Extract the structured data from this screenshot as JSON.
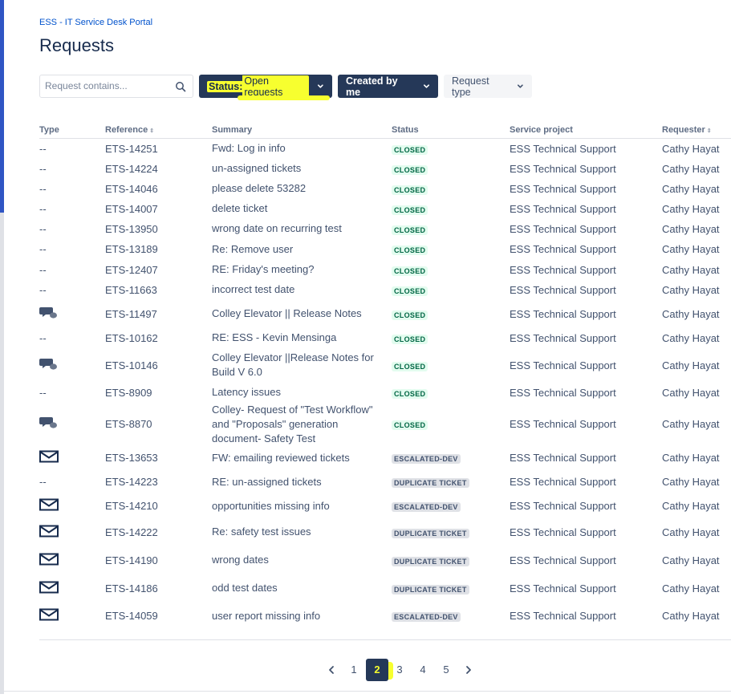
{
  "breadcrumb": "ESS - IT Service Desk Portal",
  "page_title": "Requests",
  "search": {
    "placeholder": "Request contains..."
  },
  "filters": {
    "status_label": "Status:",
    "status_value": "Open requests",
    "created_by": "Created by me",
    "request_type": "Request type"
  },
  "table": {
    "headers": [
      "Type",
      "Reference",
      "Summary",
      "Status",
      "Service project",
      "Requester"
    ],
    "rows": [
      {
        "type": "--",
        "ref": "ETS-14251",
        "summary": "Fwd: Log in info",
        "status": "CLOSED",
        "project": "ESS Technical Support",
        "requester": "Cathy Hayat"
      },
      {
        "type": "--",
        "ref": "ETS-14224",
        "summary": "un-assigned tickets",
        "status": "CLOSED",
        "project": "ESS Technical Support",
        "requester": "Cathy Hayat"
      },
      {
        "type": "--",
        "ref": "ETS-14046",
        "summary": "please delete 53282",
        "status": "CLOSED",
        "project": "ESS Technical Support",
        "requester": "Cathy Hayat"
      },
      {
        "type": "--",
        "ref": "ETS-14007",
        "summary": "delete ticket",
        "status": "CLOSED",
        "project": "ESS Technical Support",
        "requester": "Cathy Hayat"
      },
      {
        "type": "--",
        "ref": "ETS-13950",
        "summary": "wrong date on recurring test",
        "status": "CLOSED",
        "project": "ESS Technical Support",
        "requester": "Cathy Hayat"
      },
      {
        "type": "--",
        "ref": "ETS-13189",
        "summary": "Re: Remove user",
        "status": "CLOSED",
        "project": "ESS Technical Support",
        "requester": "Cathy Hayat"
      },
      {
        "type": "--",
        "ref": "ETS-12407",
        "summary": "RE: Friday's meeting?",
        "status": "CLOSED",
        "project": "ESS Technical Support",
        "requester": "Cathy Hayat"
      },
      {
        "type": "--",
        "ref": "ETS-11663",
        "summary": "incorrect test date",
        "status": "CLOSED",
        "project": "ESS Technical Support",
        "requester": "Cathy Hayat"
      },
      {
        "type": "chat-icon",
        "ref": "ETS-11497",
        "summary": "Colley Elevator || Release Notes",
        "status": "CLOSED",
        "project": "ESS Technical Support",
        "requester": "Cathy Hayat"
      },
      {
        "type": "--",
        "ref": "ETS-10162",
        "summary": "RE: ESS - Kevin Mensinga",
        "status": "CLOSED",
        "project": "ESS Technical Support",
        "requester": "Cathy Hayat"
      },
      {
        "type": "chat-icon",
        "ref": "ETS-10146",
        "summary": "Colley Elevator ||Release Notes for Build V 6.0",
        "status": "CLOSED",
        "project": "ESS Technical Support",
        "requester": "Cathy Hayat"
      },
      {
        "type": "--",
        "ref": "ETS-8909",
        "summary": "Latency issues",
        "status": "CLOSED",
        "project": "ESS Technical Support",
        "requester": "Cathy Hayat"
      },
      {
        "type": "chat-icon",
        "ref": "ETS-8870",
        "summary": "Colley- Request of \"Test Workflow\" and \"Proposals\" generation document- Safety Test",
        "status": "CLOSED",
        "project": "ESS Technical Support",
        "requester": "Cathy Hayat"
      },
      {
        "type": "email-icon",
        "ref": "ETS-13653",
        "summary": "FW: emailing reviewed tickets",
        "status": "ESCALATED-DEV",
        "project": "ESS Technical Support",
        "requester": "Cathy Hayat"
      },
      {
        "type": "--",
        "ref": "ETS-14223",
        "summary": "RE: un-assigned tickets",
        "status": "DUPLICATE TICKET",
        "project": "ESS Technical Support",
        "requester": "Cathy Hayat"
      },
      {
        "type": "email-icon",
        "ref": "ETS-14210",
        "summary": "opportunities missing info",
        "status": "ESCALATED-DEV",
        "project": "ESS Technical Support",
        "requester": "Cathy Hayat"
      },
      {
        "type": "email-icon",
        "ref": "ETS-14222",
        "summary": "Re: safety test issues",
        "status": "DUPLICATE TICKET",
        "project": "ESS Technical Support",
        "requester": "Cathy Hayat"
      },
      {
        "type": "email-icon",
        "ref": "ETS-14190",
        "summary": "wrong dates",
        "status": "DUPLICATE TICKET",
        "project": "ESS Technical Support",
        "requester": "Cathy Hayat"
      },
      {
        "type": "email-icon",
        "ref": "ETS-14186",
        "summary": "odd test dates",
        "status": "DUPLICATE TICKET",
        "project": "ESS Technical Support",
        "requester": "Cathy Hayat"
      },
      {
        "type": "email-icon",
        "ref": "ETS-14059",
        "summary": "user report missing info",
        "status": "ESCALATED-DEV",
        "project": "ESS Technical Support",
        "requester": "Cathy Hayat"
      }
    ]
  },
  "pagination": {
    "pages": [
      "1",
      "2",
      "3",
      "4",
      "5"
    ],
    "current": "2"
  },
  "colors": {
    "accent": "#2f55c4",
    "navy": "#253858",
    "highlight": "#f7ff2f",
    "closed_bg": "#e3fcef",
    "closed_text": "#006644"
  }
}
